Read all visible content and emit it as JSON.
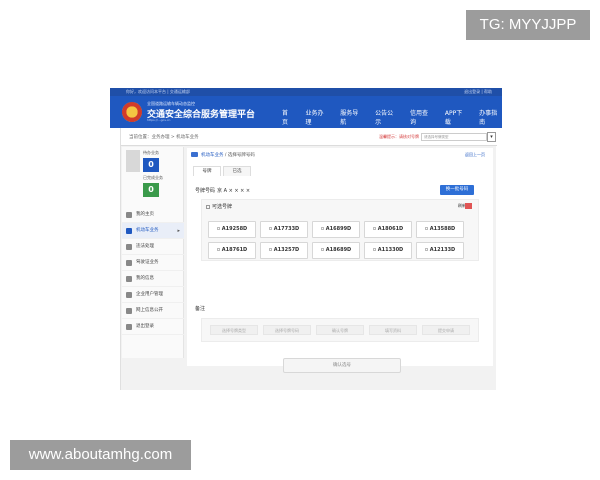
{
  "watermarks": {
    "top": "TG: MYYJJPP",
    "bottom": "www.aboutamhg.com"
  },
  "topbar": {
    "left": "你好，欢迎访问本平台 | 交通运输部",
    "right": "退出登录 | 帮助"
  },
  "header": {
    "subtitle": "全国道路运输车辆动态监控",
    "title": "交通安全综合服务管理平台",
    "url": "https://...gov.cn",
    "nav": [
      "首页",
      "业务办理",
      "服务导航",
      "公告公示",
      "信用查询",
      "APP下载",
      "办事指南"
    ]
  },
  "crumbbar": {
    "left": "当前位置：业务办理 > 机动车业务",
    "alert": "温馨提示：请核对号牌",
    "select_value": "请选择号牌类型"
  },
  "sidebar": {
    "stats": [
      {
        "label": "待办业务",
        "value": "0",
        "color": "#1f58c0"
      },
      {
        "label": "已完成业务",
        "value": "0",
        "color": "#3a9a4a"
      }
    ],
    "menu": [
      {
        "label": "我的主页",
        "icon": "home-icon",
        "active": false
      },
      {
        "label": "机动车业务",
        "icon": "car-icon",
        "active": true
      },
      {
        "label": "违法处理",
        "icon": "warning-icon",
        "active": false
      },
      {
        "label": "驾驶证业务",
        "icon": "license-icon",
        "active": false
      },
      {
        "label": "我的信息",
        "icon": "user-icon",
        "active": false
      },
      {
        "label": "企业用户管理",
        "icon": "group-icon",
        "active": false
      },
      {
        "label": "网上信息公开",
        "icon": "info-icon",
        "active": false
      },
      {
        "label": "退出登录",
        "icon": "logout-icon",
        "active": false
      }
    ]
  },
  "main": {
    "breadcrumb_section": "机动车业务",
    "breadcrumb_page": "选择号牌号码",
    "right_link": "返回上一页",
    "tabs": [
      "号牌",
      "已选"
    ],
    "plate_label": "号牌号码",
    "plate_value": "京 A × × × ×",
    "refresh_button": "换一批号码",
    "panel_title": "可选号牌",
    "panel_right": "刷新",
    "plates": [
      "A19258D",
      "A17733D",
      "A16899D",
      "A18061D",
      "A13588D",
      "A18761D",
      "A13257D",
      "A18689D",
      "A11330D",
      "A12133D"
    ],
    "remark_label": "备注",
    "remark_fields": [
      "选择号牌类型",
      "选择号牌号码",
      "确认号牌",
      "填写资料",
      "提交申请"
    ],
    "confirm_button": "确认选号"
  }
}
